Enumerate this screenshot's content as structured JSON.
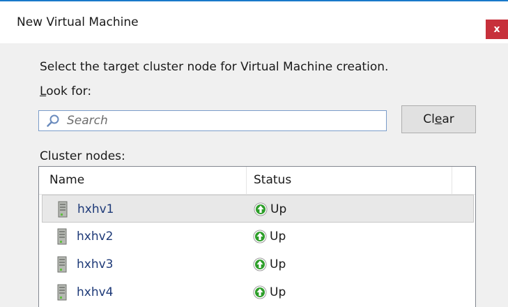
{
  "window": {
    "title": "New Virtual Machine",
    "close_label": "x"
  },
  "dialog": {
    "instruction": "Select the target cluster node for Virtual Machine creation.",
    "look_for": {
      "mnemonic": "L",
      "rest": "ook for:"
    },
    "search": {
      "placeholder": "Search",
      "value": ""
    },
    "clear_button": {
      "pre": "Cl",
      "mnemonic": "e",
      "post": "ar"
    },
    "cluster_nodes_label": "Cluster nodes:"
  },
  "table": {
    "columns": [
      "Name",
      "Status"
    ],
    "rows": [
      {
        "name": "hxhv1",
        "status": "Up",
        "selected": true
      },
      {
        "name": "hxhv2",
        "status": "Up"
      },
      {
        "name": "hxhv3",
        "status": "Up"
      },
      {
        "name": "hxhv4",
        "status": "Up"
      }
    ]
  },
  "icons": {
    "node": "server-icon",
    "status": "up-arrow-icon",
    "search": "search-icon"
  },
  "colors": {
    "accent": "#1979ca",
    "close": "#c7303b",
    "status_green": "#2e9e2a",
    "selected_row": "#e8e8e8",
    "link_text": "#1e3a78"
  }
}
